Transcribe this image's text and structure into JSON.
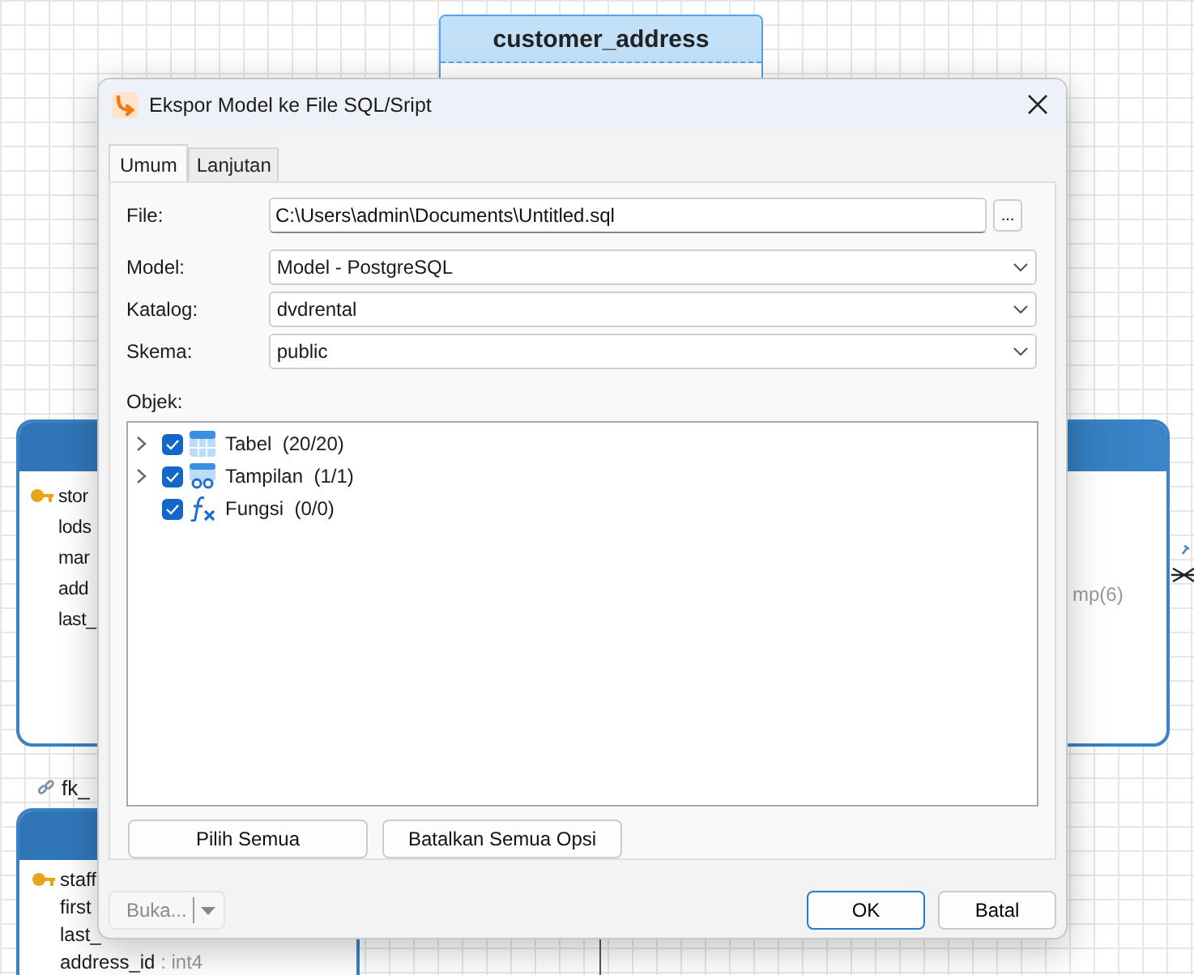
{
  "canvas": {
    "entities": [
      {
        "kind": "selected",
        "title": "customer_address"
      },
      {
        "kind": "left",
        "rows": [
          {
            "name": "stor",
            "type": "",
            "key": true
          },
          {
            "name": "lods",
            "type": "",
            "key": false
          },
          {
            "name": "mar",
            "type": "",
            "key": false
          },
          {
            "name": "add",
            "type": "",
            "key": false
          },
          {
            "name": "last_",
            "type": "",
            "key": false
          }
        ]
      },
      {
        "kind": "right",
        "rows": [
          {
            "name": "",
            "type": "mp(6)",
            "key": false
          }
        ]
      },
      {
        "kind": "bottom",
        "rows": [
          {
            "name": "staff",
            "type": "",
            "key": true
          },
          {
            "name": "first",
            "type": "",
            "key": false
          },
          {
            "name": "last_",
            "type": "",
            "key": false
          },
          {
            "name": "address_id",
            "type": ": int4",
            "key": false
          }
        ]
      }
    ],
    "relation_label": "fk_"
  },
  "dialog": {
    "title": "Ekspor Model ke File SQL/Sript",
    "tabs": [
      {
        "label": "Umum",
        "selected": true
      },
      {
        "label": "Lanjutan",
        "selected": false
      }
    ],
    "file": {
      "label": "File:",
      "value": "C:\\Users\\admin\\Documents\\Untitled.sql",
      "browse": "..."
    },
    "selects": [
      {
        "label": "Model:",
        "value": "Model - PostgreSQL"
      },
      {
        "label": "Katalog:",
        "value": "dvdrental"
      },
      {
        "label": "Skema:",
        "value": "public"
      }
    ],
    "objects_label": "Objek:",
    "tree": [
      {
        "kind": "table",
        "label": "Tabel",
        "count": "(20/20)",
        "checked": true,
        "expandable": true
      },
      {
        "kind": "view",
        "label": "Tampilan",
        "count": "(1/1)",
        "checked": true,
        "expandable": true
      },
      {
        "kind": "function",
        "label": "Fungsi",
        "count": "(0/0)",
        "checked": true,
        "expandable": false
      }
    ],
    "buttons": [
      "Pilih Semua",
      "Batalkan Semua Opsi"
    ],
    "open_button": {
      "label": "Buka...",
      "disabled": true
    },
    "ok": "OK",
    "cancel": "Batal"
  }
}
